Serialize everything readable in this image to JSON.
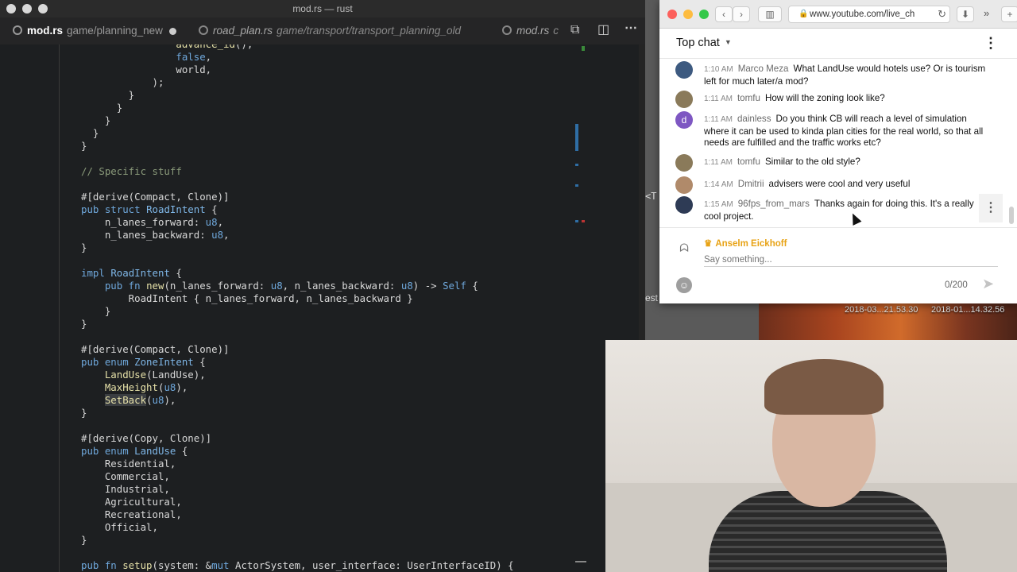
{
  "editor": {
    "window_title": "mod.rs — rust",
    "tabs": [
      {
        "name": "mod.rs",
        "path": "game/planning_new",
        "active": true
      },
      {
        "name": "road_plan.rs",
        "path": "game/transport/transport_planning_old",
        "active": false
      },
      {
        "name": "mod.rs",
        "path": "c",
        "active": false
      }
    ],
    "code_lines": [
      {
        "html": "                <span class='fn'>advance_id</span>(),",
        "seg": []
      },
      {
        "seg": [
          [
            "",
            "                "
          ],
          [
            "kw",
            "false"
          ],
          [
            "",
            ","
          ]
        ]
      },
      {
        "seg": [
          [
            "",
            "                world,"
          ]
        ]
      },
      {
        "seg": [
          [
            "",
            "            );"
          ]
        ]
      },
      {
        "seg": [
          [
            "",
            "        }"
          ]
        ]
      },
      {
        "seg": [
          [
            "",
            "      }"
          ]
        ]
      },
      {
        "seg": [
          [
            "",
            "    }"
          ]
        ]
      },
      {
        "seg": [
          [
            "",
            "  }"
          ]
        ]
      },
      {
        "seg": [
          [
            "",
            "}"
          ]
        ]
      },
      {
        "seg": [
          [
            "",
            ""
          ]
        ]
      },
      {
        "seg": [
          [
            "cm",
            "// Specific stuff"
          ]
        ]
      },
      {
        "seg": [
          [
            "",
            ""
          ]
        ]
      },
      {
        "seg": [
          [
            "",
            "#[derive(Compact, Clone)]"
          ]
        ]
      },
      {
        "seg": [
          [
            "kw",
            "pub struct "
          ],
          [
            "ty",
            "RoadIntent"
          ],
          [
            "",
            " {"
          ]
        ]
      },
      {
        "seg": [
          [
            "",
            "    n_lanes_forward: "
          ],
          [
            "kw",
            "u8"
          ],
          [
            "",
            ","
          ]
        ]
      },
      {
        "seg": [
          [
            "",
            "    n_lanes_backward: "
          ],
          [
            "kw",
            "u8"
          ],
          [
            "",
            ","
          ]
        ]
      },
      {
        "seg": [
          [
            "",
            "}"
          ]
        ]
      },
      {
        "seg": [
          [
            "",
            ""
          ]
        ]
      },
      {
        "seg": [
          [
            "kw",
            "impl "
          ],
          [
            "ty",
            "RoadIntent"
          ],
          [
            "",
            " {"
          ]
        ]
      },
      {
        "seg": [
          [
            "",
            "    "
          ],
          [
            "kw",
            "pub fn "
          ],
          [
            "fn",
            "new"
          ],
          [
            "",
            "(n_lanes_forward: "
          ],
          [
            "kw",
            "u8"
          ],
          [
            "",
            ", n_lanes_backward: "
          ],
          [
            "kw",
            "u8"
          ],
          [
            "",
            ") -> "
          ],
          [
            "kw",
            "Self"
          ],
          [
            "",
            " {"
          ]
        ]
      },
      {
        "seg": [
          [
            "",
            "        RoadIntent { n_lanes_forward, n_lanes_backward }"
          ]
        ]
      },
      {
        "seg": [
          [
            "",
            "    }"
          ]
        ]
      },
      {
        "seg": [
          [
            "",
            "}"
          ]
        ]
      },
      {
        "seg": [
          [
            "",
            ""
          ]
        ]
      },
      {
        "seg": [
          [
            "",
            "#[derive(Compact, Clone)]"
          ]
        ]
      },
      {
        "seg": [
          [
            "kw",
            "pub enum "
          ],
          [
            "ty",
            "ZoneIntent"
          ],
          [
            "",
            " {"
          ]
        ]
      },
      {
        "seg": [
          [
            "",
            "    "
          ],
          [
            "fn",
            "LandUse"
          ],
          [
            "",
            "(LandUse),"
          ]
        ]
      },
      {
        "seg": [
          [
            "",
            "    "
          ],
          [
            "fn",
            "MaxHeight"
          ],
          [
            "",
            "("
          ],
          [
            "kw",
            "u8"
          ],
          [
            "",
            "),"
          ]
        ]
      },
      {
        "seg": [
          [
            "",
            "    "
          ],
          [
            "fnhl",
            "SetBack"
          ],
          [
            "",
            "("
          ],
          [
            "kw",
            "u8"
          ],
          [
            "",
            "),"
          ]
        ]
      },
      {
        "seg": [
          [
            "",
            "}"
          ]
        ]
      },
      {
        "seg": [
          [
            "",
            ""
          ]
        ]
      },
      {
        "seg": [
          [
            "",
            "#[derive(Copy, Clone)]"
          ]
        ]
      },
      {
        "seg": [
          [
            "kw",
            "pub enum "
          ],
          [
            "ty",
            "LandUse"
          ],
          [
            "",
            " {"
          ]
        ]
      },
      {
        "seg": [
          [
            "",
            "    Residential,"
          ]
        ]
      },
      {
        "seg": [
          [
            "",
            "    Commercial,"
          ]
        ]
      },
      {
        "seg": [
          [
            "",
            "    Industrial,"
          ]
        ]
      },
      {
        "seg": [
          [
            "",
            "    Agricultural,"
          ]
        ]
      },
      {
        "seg": [
          [
            "",
            "    Recreational,"
          ]
        ]
      },
      {
        "seg": [
          [
            "",
            "    Official,"
          ]
        ]
      },
      {
        "seg": [
          [
            "",
            "}"
          ]
        ]
      },
      {
        "seg": [
          [
            "",
            ""
          ]
        ]
      },
      {
        "seg": [
          [
            "kw",
            "pub fn "
          ],
          [
            "fn",
            "setup"
          ],
          [
            "",
            "(system: &"
          ],
          [
            "kw",
            "mut"
          ],
          [
            "",
            " ActorSystem, user_interface: UserInterfaceID) {"
          ]
        ]
      }
    ]
  },
  "browser": {
    "url": "www.youtube.com/live_ch",
    "chat": {
      "title": "Top chat",
      "messages": [
        {
          "time": "1:10 AM",
          "author": "Marco Meza",
          "text": "What LandUse would hotels use? Or is tourism left for much later/a mod?",
          "avatar_color": "#3d5a80",
          "avatar_letter": ""
        },
        {
          "time": "1:11 AM",
          "author": "tomfu",
          "text": "How will the zoning look like?",
          "avatar_color": "#8a7a5a",
          "avatar_letter": ""
        },
        {
          "time": "1:11 AM",
          "author": "dainless",
          "text": "Do you think CB will reach a level of simulation where it can be used to kinda plan cities for the real world, so that all needs are fulfilled and the traffic works etc?",
          "avatar_color": "#7e57c2",
          "avatar_letter": "d"
        },
        {
          "time": "1:11 AM",
          "author": "tomfu",
          "text": "Similar to the old style?",
          "avatar_color": "#8a7a5a",
          "avatar_letter": ""
        },
        {
          "time": "1:14 AM",
          "author": "Dmitrii",
          "text": "advisers were cool and very useful",
          "avatar_color": "#b08a6a",
          "avatar_letter": ""
        },
        {
          "time": "1:15 AM",
          "author": "96fps_from_mars",
          "text": "Thanks again for doing this. It's a really cool project.",
          "avatar_color": "#2e3b55",
          "avatar_letter": ""
        }
      ],
      "me": "Anselm Eickhoff",
      "placeholder": "Say something...",
      "char_count": "0/200"
    }
  },
  "desktop": {
    "thumb_labels": [
      "2018-03...21.53.30",
      "2018-01...14.32.56"
    ],
    "fragment_top": "<T",
    "fragment_bottom": "est"
  },
  "colors": {
    "accent_owner": "#e8a316",
    "editor_bg": "#1d1f21"
  }
}
